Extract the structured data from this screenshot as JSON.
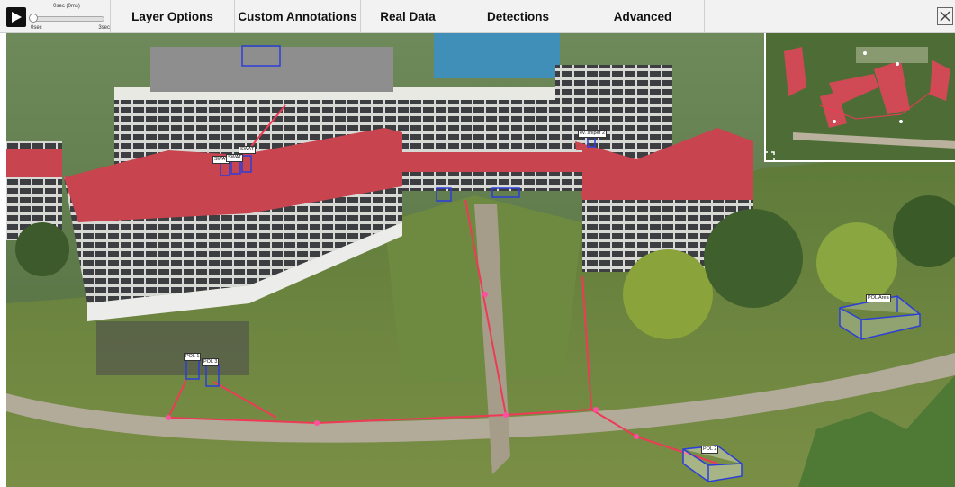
{
  "toolbar": {
    "timeline": {
      "current_label": "0sec (0ms)",
      "start_label": "0sec",
      "end_label": "3sec",
      "position": 0.0
    },
    "menu": [
      {
        "label": "Layer Options"
      },
      {
        "label": "Custom Annotations"
      },
      {
        "label": "Real Data"
      },
      {
        "label": "Detections"
      },
      {
        "label": "Advanced"
      }
    ],
    "icons": {
      "play": "play-icon",
      "close": "close-icon",
      "expand": "expand-icon"
    }
  },
  "scene": {
    "annotations": [
      {
        "label": "SWAT"
      },
      {
        "label": "SWAT"
      },
      {
        "label": "SWAT"
      },
      {
        "label": "ev. sniper 2"
      },
      {
        "label": "POL 1"
      },
      {
        "label": "POL 2"
      },
      {
        "label": "POL 3"
      },
      {
        "label": "POL Area"
      }
    ]
  },
  "colors": {
    "route": "#ee3a56",
    "waypoint": "#ff4fa0",
    "annotation_box": "#2b3fd8",
    "roof": "#c8454f",
    "toolbar_bg": "#f2f2f2"
  }
}
